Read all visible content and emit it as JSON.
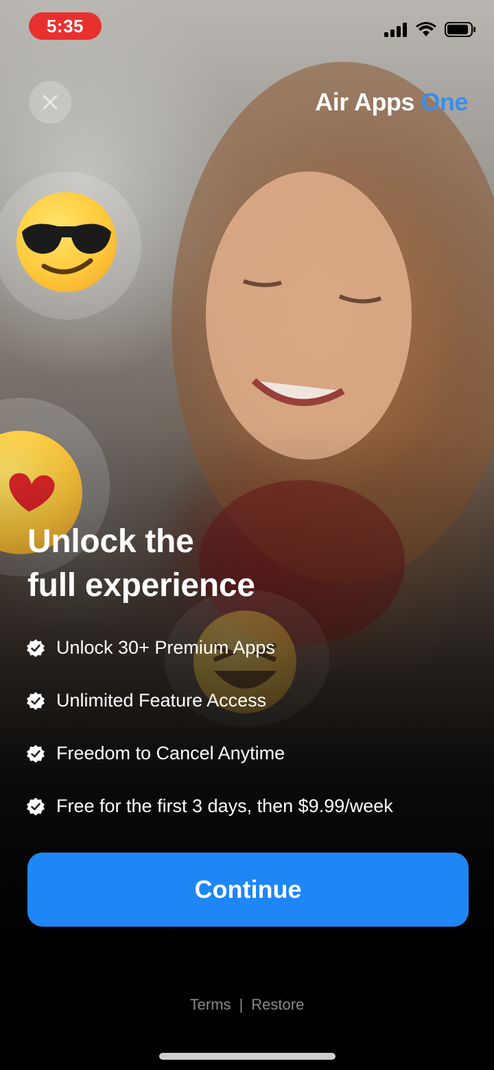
{
  "status_bar": {
    "time": "5:35",
    "icons": [
      "cellular-signal-icon",
      "wifi-icon",
      "battery-icon"
    ],
    "time_pill_color": "#e8312f"
  },
  "close_button": {
    "icon": "close-icon"
  },
  "brand": {
    "name": "Air Apps",
    "accent": "One",
    "accent_color": "#3a8fe8"
  },
  "decorations": [
    "sunglasses-emoji",
    "heart-eyes-emoji",
    "laughing-emoji"
  ],
  "headline": {
    "line1": "Unlock the",
    "line2": "full experience"
  },
  "features": [
    {
      "icon": "verified-check-icon",
      "label": "Unlock 30+ Premium Apps"
    },
    {
      "icon": "verified-check-icon",
      "label": "Unlimited Feature Access"
    },
    {
      "icon": "verified-check-icon",
      "label": "Freedom to Cancel Anytime"
    },
    {
      "icon": "verified-check-icon",
      "label": "Free for the first 3 days, then $9.99/week"
    }
  ],
  "cta": {
    "label": "Continue",
    "color": "#1f86f6"
  },
  "footer": {
    "terms": "Terms",
    "separator": "|",
    "restore": "Restore"
  }
}
